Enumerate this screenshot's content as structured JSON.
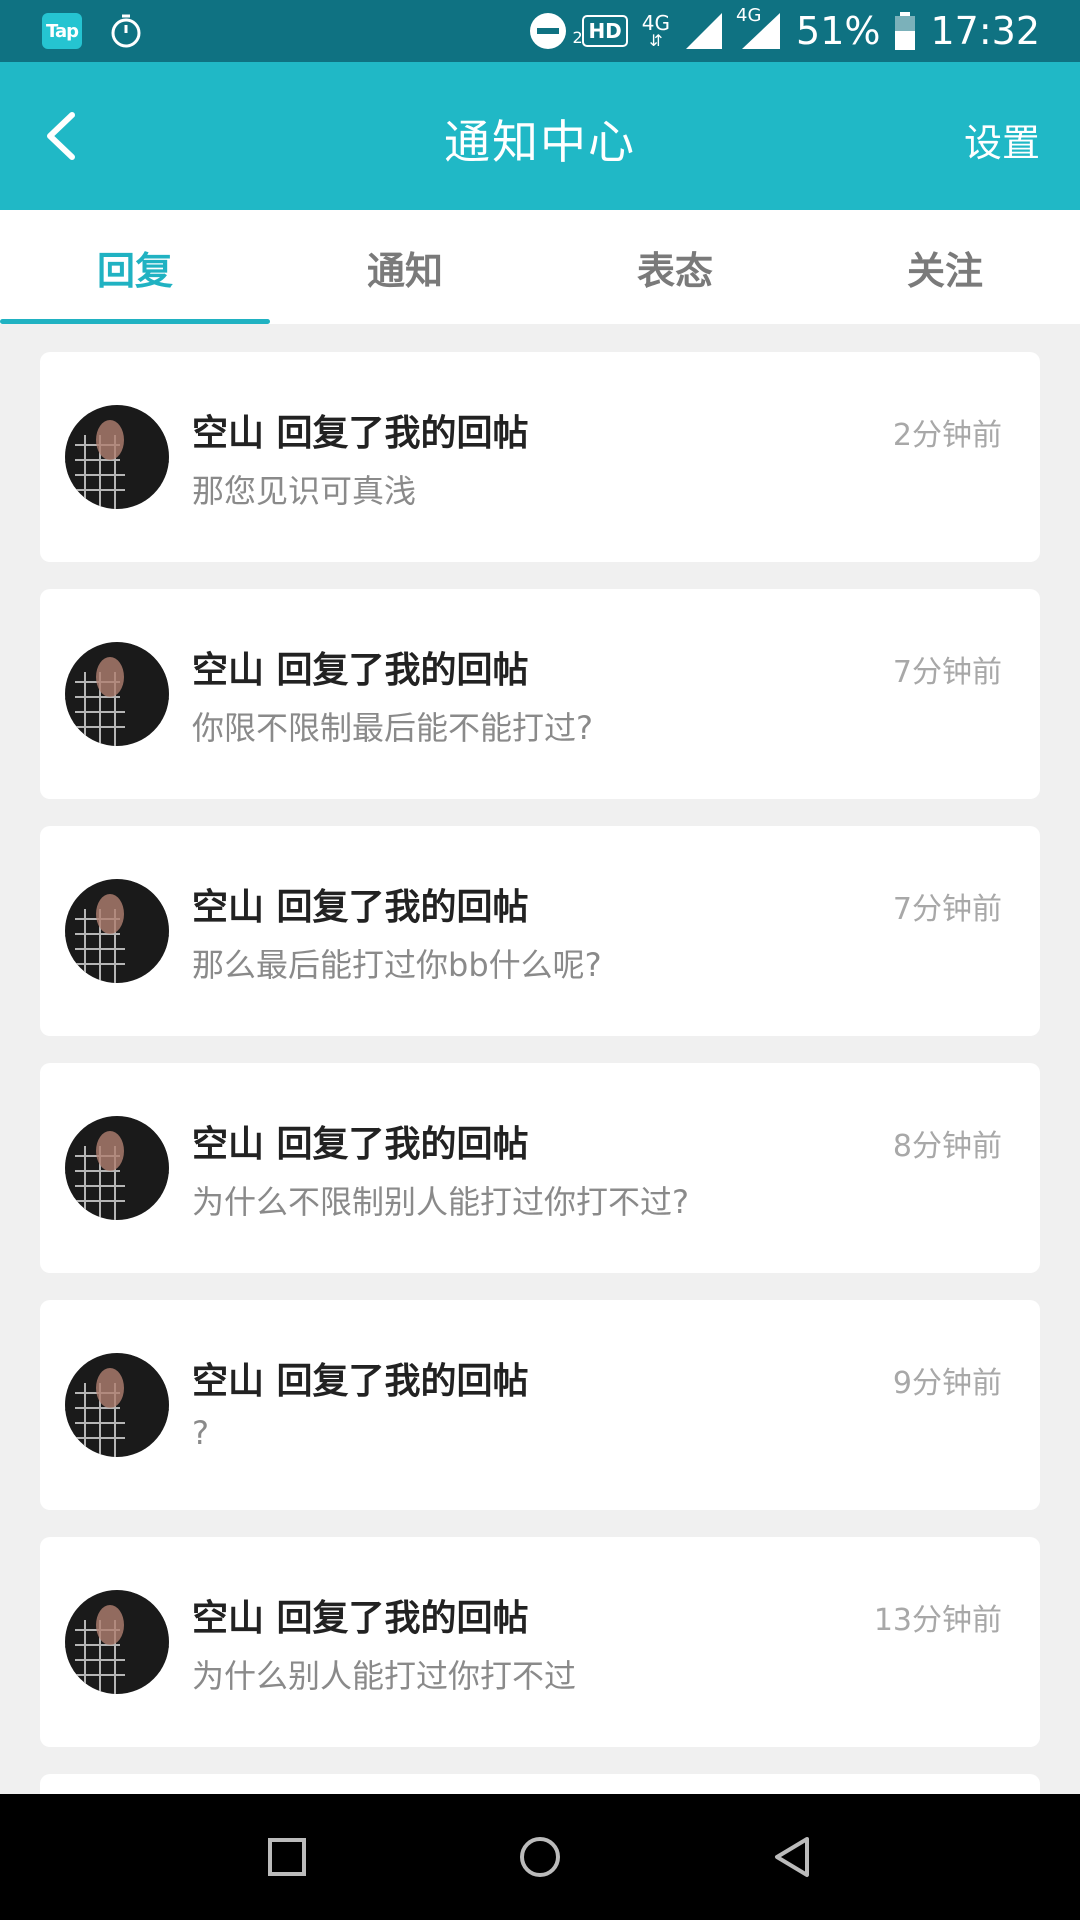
{
  "status_bar": {
    "tap_label": "Tap",
    "hd_label": "HD",
    "sim_number": "2",
    "network_1": "4G",
    "network_2": "4G",
    "battery": "51%",
    "time": "17:32"
  },
  "app_bar": {
    "title": "通知中心",
    "settings_label": "设置"
  },
  "tabs": [
    {
      "label": "回复",
      "active": true
    },
    {
      "label": "通知",
      "active": false
    },
    {
      "label": "表态",
      "active": false
    },
    {
      "label": "关注",
      "active": false
    }
  ],
  "notifications": [
    {
      "title": "空山 回复了我的回帖",
      "time": "2分钟前",
      "body": "那您见识可真浅"
    },
    {
      "title": "空山 回复了我的回帖",
      "time": "7分钟前",
      "body": "你限不限制最后能不能打过?"
    },
    {
      "title": "空山 回复了我的回帖",
      "time": "7分钟前",
      "body": "那么最后能打过你bb什么呢?"
    },
    {
      "title": "空山 回复了我的回帖",
      "time": "8分钟前",
      "body": "为什么不限制别人能打过你打不过?"
    },
    {
      "title": "空山 回复了我的回帖",
      "time": "9分钟前",
      "body": "?"
    },
    {
      "title": "空山 回复了我的回帖",
      "time": "13分钟前",
      "body": "为什么别人能打过你打不过"
    }
  ],
  "colors": {
    "status_bar": "#0f7282",
    "app_bar": "#20b8c6",
    "accent": "#20b2c2"
  }
}
